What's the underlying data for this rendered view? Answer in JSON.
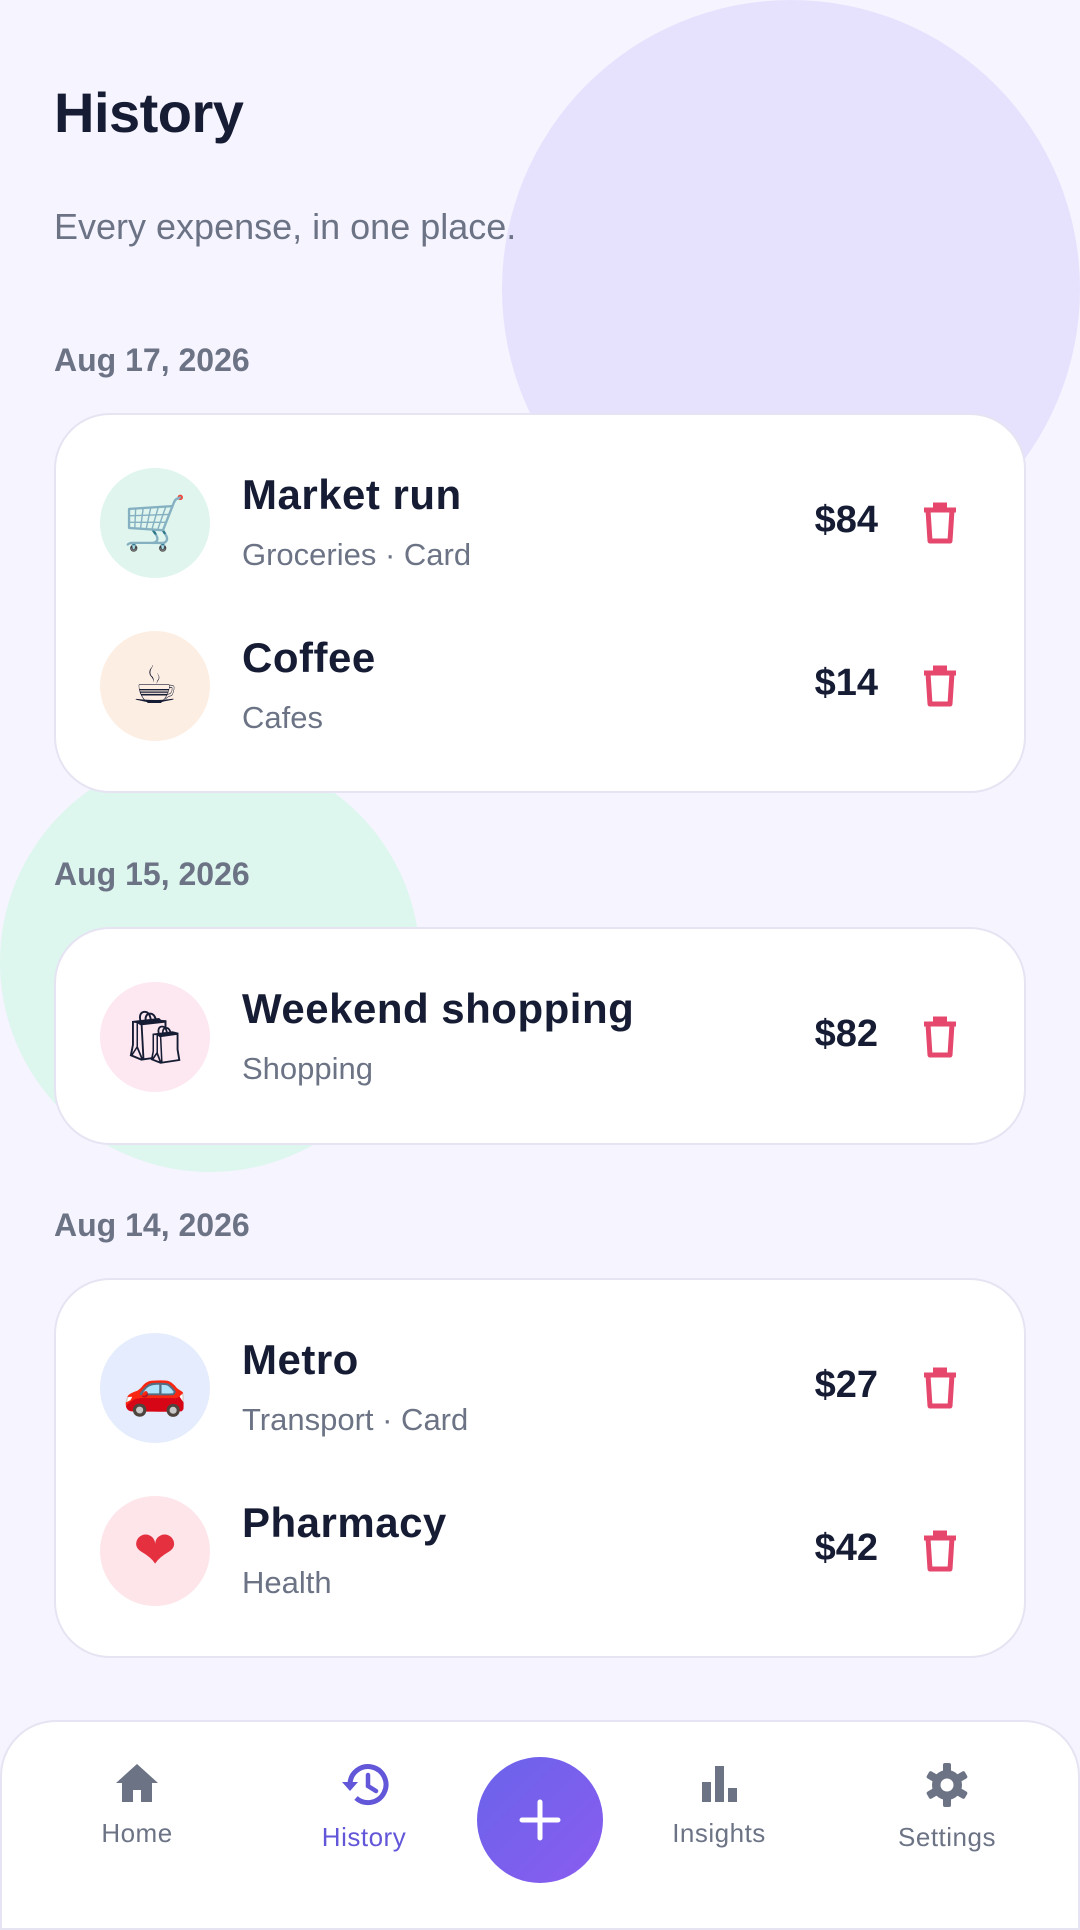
{
  "header": {
    "title": "History",
    "subtitle": "Every expense, in one place."
  },
  "groups": [
    {
      "date": "Aug 17, 2026",
      "items": [
        {
          "title": "Market run",
          "subtitle": "Groceries · Card",
          "amount": "$84",
          "icon": "🛒",
          "icon_name": "shopping-cart-icon",
          "icon_bg": "#dff5ee"
        },
        {
          "title": "Coffee",
          "subtitle": "Cafes",
          "amount": "$14",
          "icon": "☕",
          "icon_name": "coffee-cup-icon",
          "icon_bg": "#fdeee3"
        }
      ]
    },
    {
      "date": "Aug 15, 2026",
      "items": [
        {
          "title": "Weekend shopping",
          "subtitle": "Shopping",
          "amount": "$82",
          "icon": "🛍",
          "icon_name": "shopping-bags-icon",
          "icon_bg": "#fde7f1"
        }
      ]
    },
    {
      "date": "Aug 14, 2026",
      "items": [
        {
          "title": "Metro",
          "subtitle": "Transport · Card",
          "amount": "$27",
          "icon": "🚗",
          "icon_name": "car-icon",
          "icon_bg": "#e4ecfd"
        },
        {
          "title": "Pharmacy",
          "subtitle": "Health",
          "amount": "$42",
          "icon": "❤",
          "icon_name": "heart-icon",
          "icon_bg": "#fde5ea"
        }
      ]
    }
  ],
  "nav": {
    "home": "Home",
    "history": "History",
    "insights": "Insights",
    "settings": "Settings",
    "active": "history",
    "add_icon": "plus-icon"
  },
  "colors": {
    "background": "#f6f4ff",
    "accent": "#6256d9",
    "delete": "#e5476d",
    "text_primary": "#161c33",
    "text_secondary": "#6b7385"
  }
}
